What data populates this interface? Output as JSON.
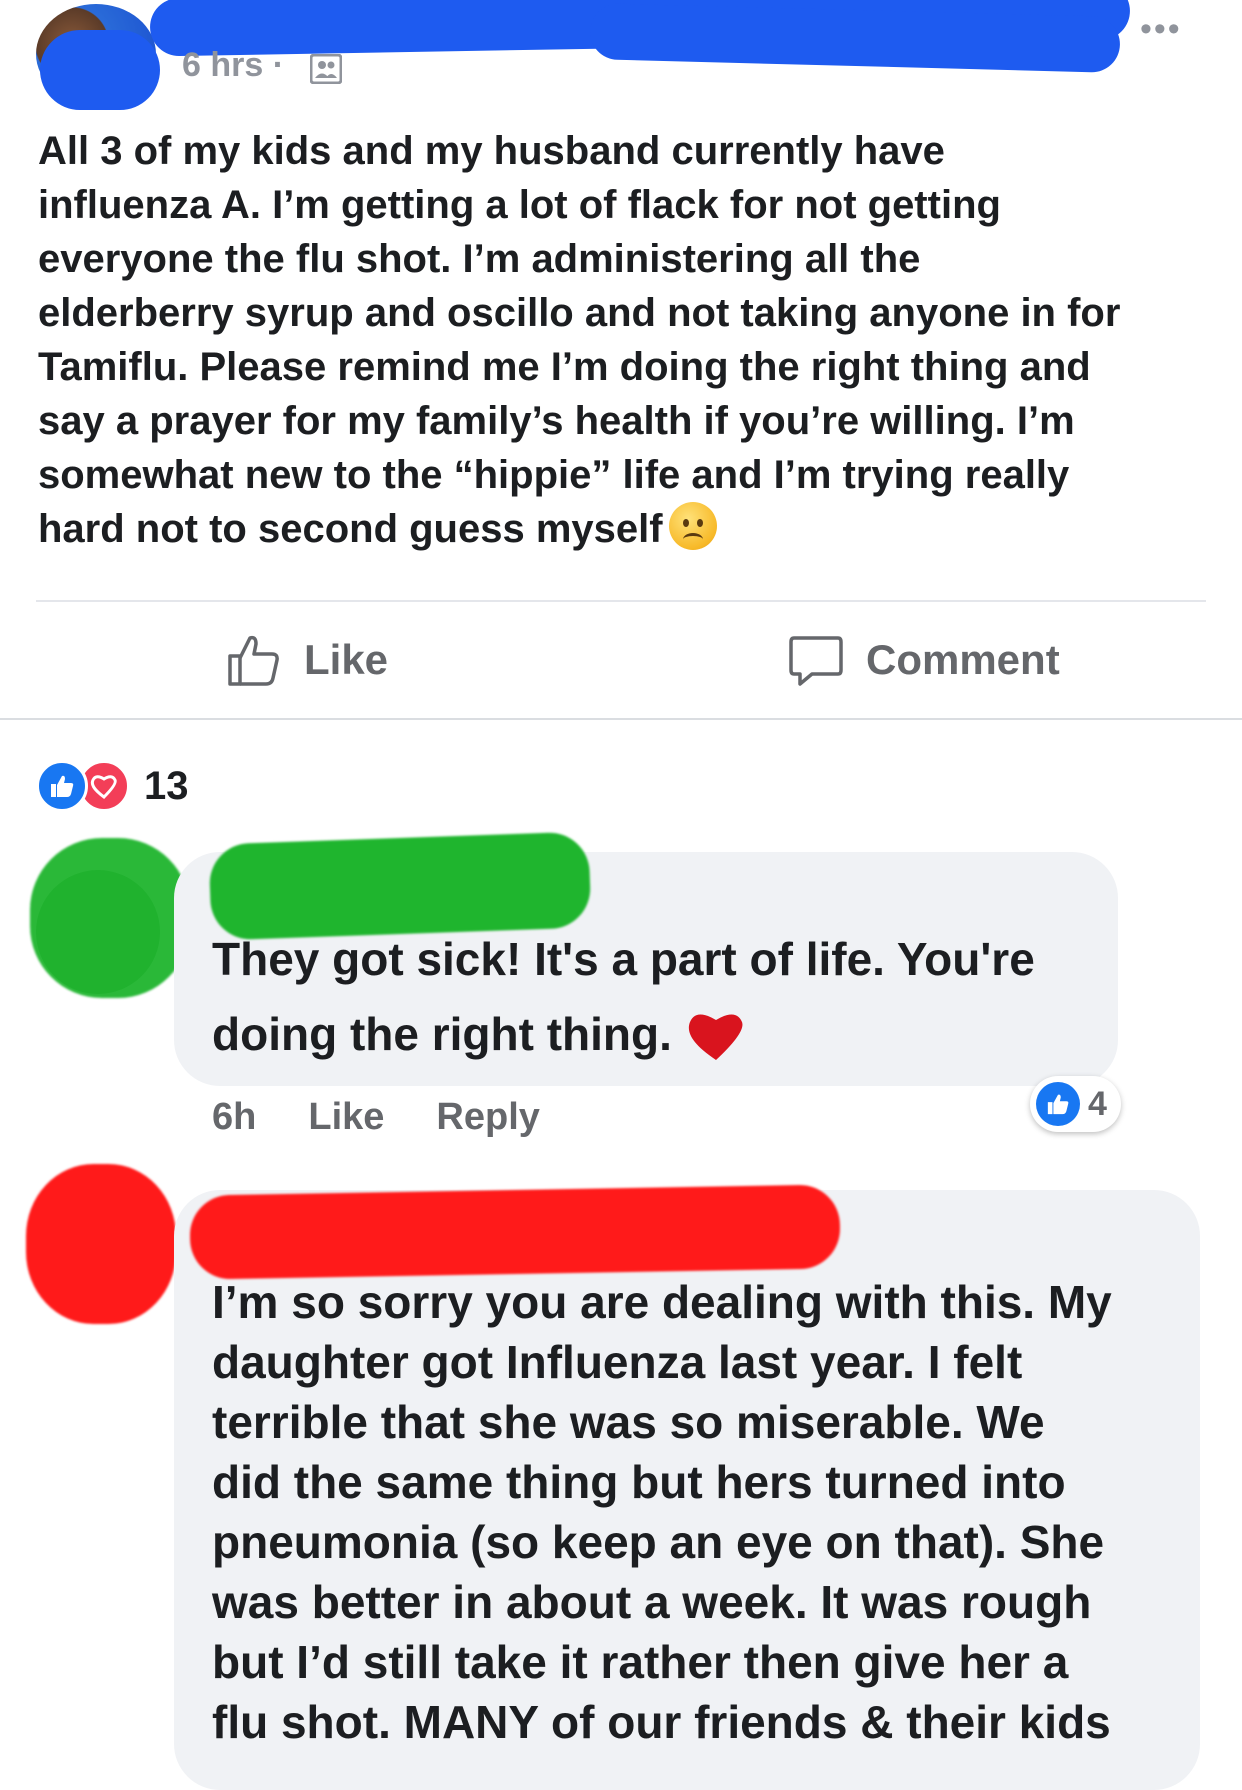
{
  "post": {
    "time": "6 hrs ·",
    "audience_icon": "friends-icon",
    "more_icon": "•••",
    "text": "All 3 of my kids and my husband currently have\ninfluenza A. I’m getting a lot of flack for not getting\neveryone the flu shot. I’m administering all the\nelderberry syrup and oscillo and not taking anyone in for\nTamiflu. Please remind me I’m doing the right thing and\nsay a prayer for my family’s health if you’re willing. I’m\nsomewhat new to the “hippie” life and I’m trying really\nhard not to second guess myself",
    "emoji": "worried-face-emoji"
  },
  "actions": {
    "like_label": "Like",
    "comment_label": "Comment"
  },
  "reactions": {
    "count": "13",
    "types": [
      "like",
      "love"
    ],
    "colors": {
      "like": "#1877f2",
      "love": "#f33e58"
    }
  },
  "comments": [
    {
      "text": "They got sick! It's a part of life. You're\ndoing the right thing.",
      "emoji": "red-heart-emoji",
      "time": "6h",
      "like_label": "Like",
      "reply_label": "Reply",
      "like_count": "4"
    },
    {
      "text": "I’m so sorry you are dealing with this. My\ndaughter got Influenza last year. I felt\nterrible that she was so miserable. We\ndid the same thing but hers turned into\npneumonia (so keep an eye on that). She\nwas better in about a week. It was rough\nbut I’d still take it rather then give her a\nflu shot. MANY of our friends & their kids"
    }
  ],
  "colors": {
    "redaction_blue": "#1e5bf0",
    "redaction_green": "#1fb52e",
    "redaction_red": "#ff1a1a",
    "bubble": "#f0f2f5",
    "secondary_text": "#65676b"
  }
}
